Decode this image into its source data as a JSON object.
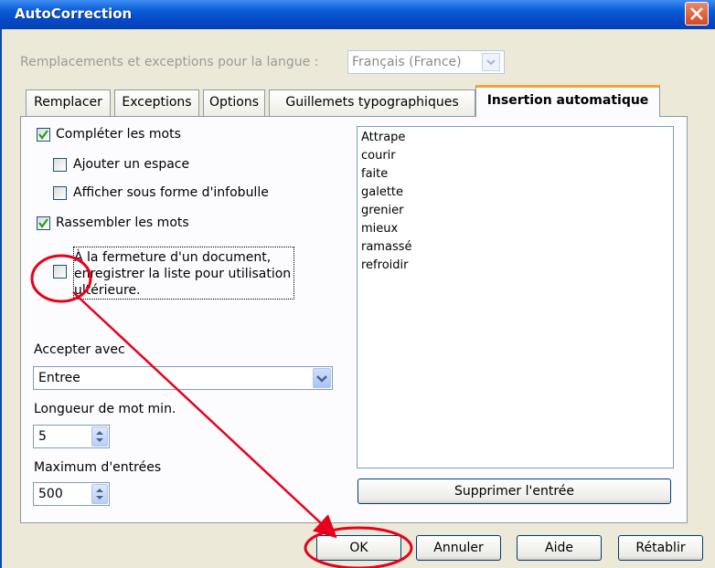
{
  "window": {
    "title": "AutoCorrection"
  },
  "language": {
    "label": "Remplacements et exceptions pour la langue :",
    "value": "Français (France)"
  },
  "tabs": [
    {
      "label": "Remplacer",
      "active": false
    },
    {
      "label": "Exceptions",
      "active": false
    },
    {
      "label": "Options",
      "active": false
    },
    {
      "label": "Guillemets typographiques",
      "active": false
    },
    {
      "label": "Insertion automatique",
      "active": true
    }
  ],
  "options": {
    "complete_words": {
      "label": "Compléter les mots",
      "checked": true
    },
    "add_space": {
      "label": "Ajouter un espace",
      "checked": false
    },
    "show_tooltip": {
      "label": "Afficher sous forme d'infobulle",
      "checked": false
    },
    "collect_words": {
      "label": "Rassembler les mots",
      "checked": true
    },
    "save_list": {
      "line1": "À la fermeture d'un document,",
      "line2": "enregistrer la liste pour utilisation",
      "line3": "ultérieure.",
      "checked": false
    }
  },
  "accept": {
    "label": "Accepter avec",
    "value": "Entree"
  },
  "min_length": {
    "label": "Longueur de mot min.",
    "value": "5"
  },
  "max_entries": {
    "label": "Maximum d'entrées",
    "value": "500"
  },
  "word_list": [
    "Attrape",
    "courir",
    "faite",
    "galette",
    "grenier",
    "mieux",
    "ramassé",
    "refroidir"
  ],
  "buttons": {
    "delete_entry": "Supprimer l'entrée",
    "ok": "OK",
    "cancel": "Annuler",
    "help": "Aide",
    "reset": "Rétablir"
  },
  "colors": {
    "annotation": "#e8001a",
    "title_bar": "#0a5fd8",
    "active_tab_accent": "#f3a33d"
  }
}
